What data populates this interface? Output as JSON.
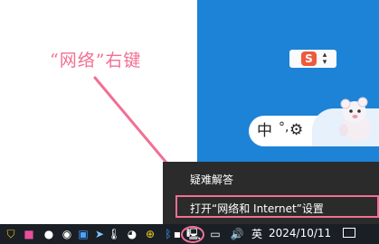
{
  "annotation": {
    "text": "“网络”右键",
    "color": "#f26f93"
  },
  "context_menu": {
    "items": [
      {
        "label": "疑难解答"
      },
      {
        "label": "打开“网络和 Internet”设置",
        "highlighted": true
      }
    ]
  },
  "input_method": {
    "sogou_logo": "S",
    "language": "中",
    "punctuation": "°,",
    "settings_icon": "gear-icon"
  },
  "taskbar": {
    "clock_date": "2024/10/11",
    "network_icon": "network-icon",
    "volume_icon": "speaker-icon",
    "notification_icon": "notification-icon"
  },
  "colors": {
    "desktop": "#1d83d6",
    "menu_bg": "#2b2b2b",
    "taskbar_bg": "#1a1f26",
    "highlight": "#f26f93"
  }
}
